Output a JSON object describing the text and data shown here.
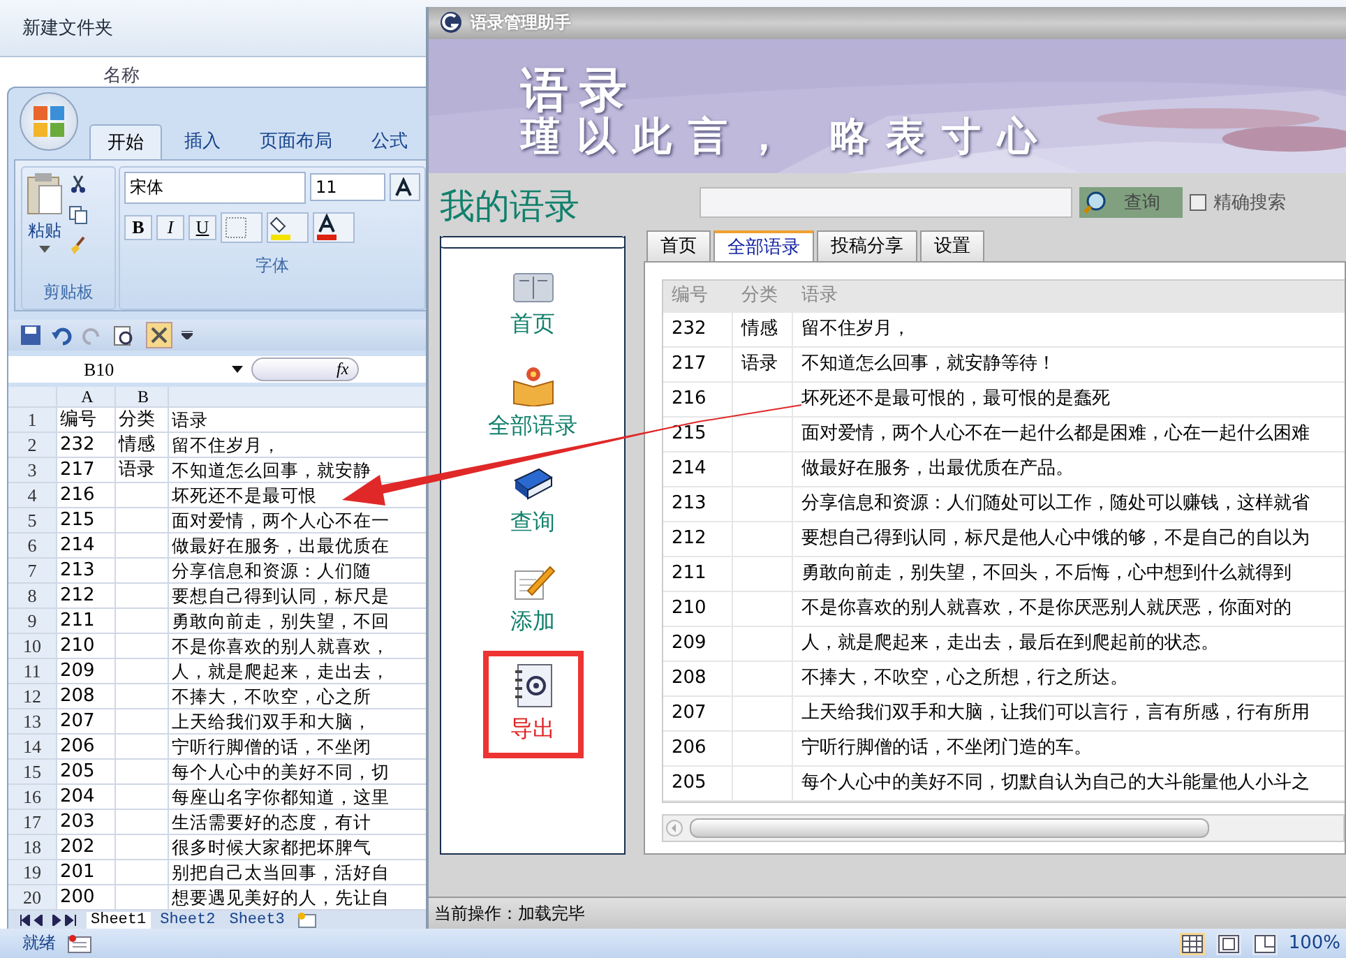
{
  "explorer": {
    "toolbar_button": "新建文件夹",
    "column": "名称"
  },
  "excel": {
    "ribbon_tabs": [
      {
        "label": "开始",
        "selected": true
      },
      {
        "label": "插入",
        "selected": false
      },
      {
        "label": "页面布局",
        "selected": false
      },
      {
        "label": "公式",
        "selected": false
      }
    ],
    "clipboard": {
      "paste": "粘贴",
      "group": "剪贴板"
    },
    "font": {
      "name": "宋体",
      "size": "11",
      "bold": "B",
      "italic": "I",
      "underline": "U",
      "group": "字体"
    },
    "name_box": "B10",
    "fx": "fx",
    "columns": [
      "",
      "A",
      "B",
      ""
    ],
    "rows": [
      [
        "1",
        "编号",
        "分类",
        "语录"
      ],
      [
        "2",
        "232",
        "情感",
        "留不住岁月，"
      ],
      [
        "3",
        "217",
        "语录",
        "不知道怎么回事，就安静"
      ],
      [
        "4",
        "216",
        "",
        "坏死还不是最可恨"
      ],
      [
        "5",
        "215",
        "",
        "面对爱情，两个人心不在一"
      ],
      [
        "6",
        "214",
        "",
        "做最好在服务，出最优质在"
      ],
      [
        "7",
        "213",
        "",
        "分享信息和资源：人们随"
      ],
      [
        "8",
        "212",
        "",
        "要想自己得到认同，标尺是"
      ],
      [
        "9",
        "211",
        "",
        "勇敢向前走，别失望，不回"
      ],
      [
        "10",
        "210",
        "",
        "不是你喜欢的别人就喜欢，"
      ],
      [
        "11",
        "209",
        "",
        "人，就是爬起来，走出去，"
      ],
      [
        "12",
        "208",
        "",
        "不捧大，不吹空，心之所"
      ],
      [
        "13",
        "207",
        "",
        "上天给我们双手和大脑，"
      ],
      [
        "14",
        "206",
        "",
        "宁听行脚僧的话，不坐闭"
      ],
      [
        "15",
        "205",
        "",
        "每个人心中的美好不同，切"
      ],
      [
        "16",
        "204",
        "",
        "每座山名字你都知道，这里"
      ],
      [
        "17",
        "203",
        "",
        "生活需要好的态度，有计"
      ],
      [
        "18",
        "202",
        "",
        "很多时候大家都把坏脾气"
      ],
      [
        "19",
        "201",
        "",
        "别把自己太当回事，活好自"
      ],
      [
        "20",
        "200",
        "",
        "想要遇见美好的人，先让自"
      ]
    ],
    "sheets": [
      {
        "label": "Sheet1",
        "selected": true
      },
      {
        "label": "Sheet2",
        "selected": false
      },
      {
        "label": "Sheet3",
        "selected": false
      }
    ],
    "status": "就绪",
    "zoom": "100%"
  },
  "app": {
    "title": "语录管理助手",
    "banner": {
      "title": "语录",
      "subtitle": "瑾以此言， 略表寸心"
    },
    "heading": "我的语录",
    "search": {
      "button": "查询",
      "exact": {
        "label": "精确搜索",
        "checked": false
      }
    },
    "nav": [
      {
        "label": "首页",
        "highlighted": false
      },
      {
        "label": "全部语录",
        "highlighted": false
      },
      {
        "label": "查询",
        "highlighted": false
      },
      {
        "label": "添加",
        "highlighted": false
      },
      {
        "label": "导出",
        "highlighted": true
      }
    ],
    "tabs": [
      {
        "label": "首页",
        "selected": false
      },
      {
        "label": "全部语录",
        "selected": true
      },
      {
        "label": "投稿分享",
        "selected": false
      },
      {
        "label": "设置",
        "selected": false
      }
    ],
    "table": {
      "columns": [
        "编号",
        "分类",
        "语录"
      ],
      "rows": [
        [
          "232",
          "情感",
          "留不住岁月，"
        ],
        [
          "217",
          "语录",
          "不知道怎么回事，就安静等待！"
        ],
        [
          "216",
          "",
          "坏死还不是最可恨的，最可恨的是蠢死"
        ],
        [
          "215",
          "",
          "面对爱情，两个人心不在一起什么都是困难，心在一起什么困难"
        ],
        [
          "214",
          "",
          "做最好在服务，出最优质在产品。"
        ],
        [
          "213",
          "",
          "分享信息和资源：人们随处可以工作，随处可以赚钱，这样就省"
        ],
        [
          "212",
          "",
          "要想自己得到认同，标尺是他人心中饿的够，不是自己的自以为"
        ],
        [
          "211",
          "",
          "勇敢向前走，别失望，不回头，不后悔，心中想到什么就得到"
        ],
        [
          "210",
          "",
          "不是你喜欢的别人就喜欢，不是你厌恶别人就厌恶，你面对的"
        ],
        [
          "209",
          "",
          "人，就是爬起来，走出去，最后在到爬起前的状态。"
        ],
        [
          "208",
          "",
          "不捧大，不吹空，心之所想，行之所达。"
        ],
        [
          "207",
          "",
          "上天给我们双手和大脑，让我们可以言行，言有所感，行有所用"
        ],
        [
          "206",
          "",
          "宁听行脚僧的话，不坐闭门造的车。"
        ],
        [
          "205",
          "",
          "每个人心中的美好不同，切默自认为自己的大斗能量他人小斗之"
        ]
      ]
    },
    "status": "当前操作：加载完毕"
  }
}
